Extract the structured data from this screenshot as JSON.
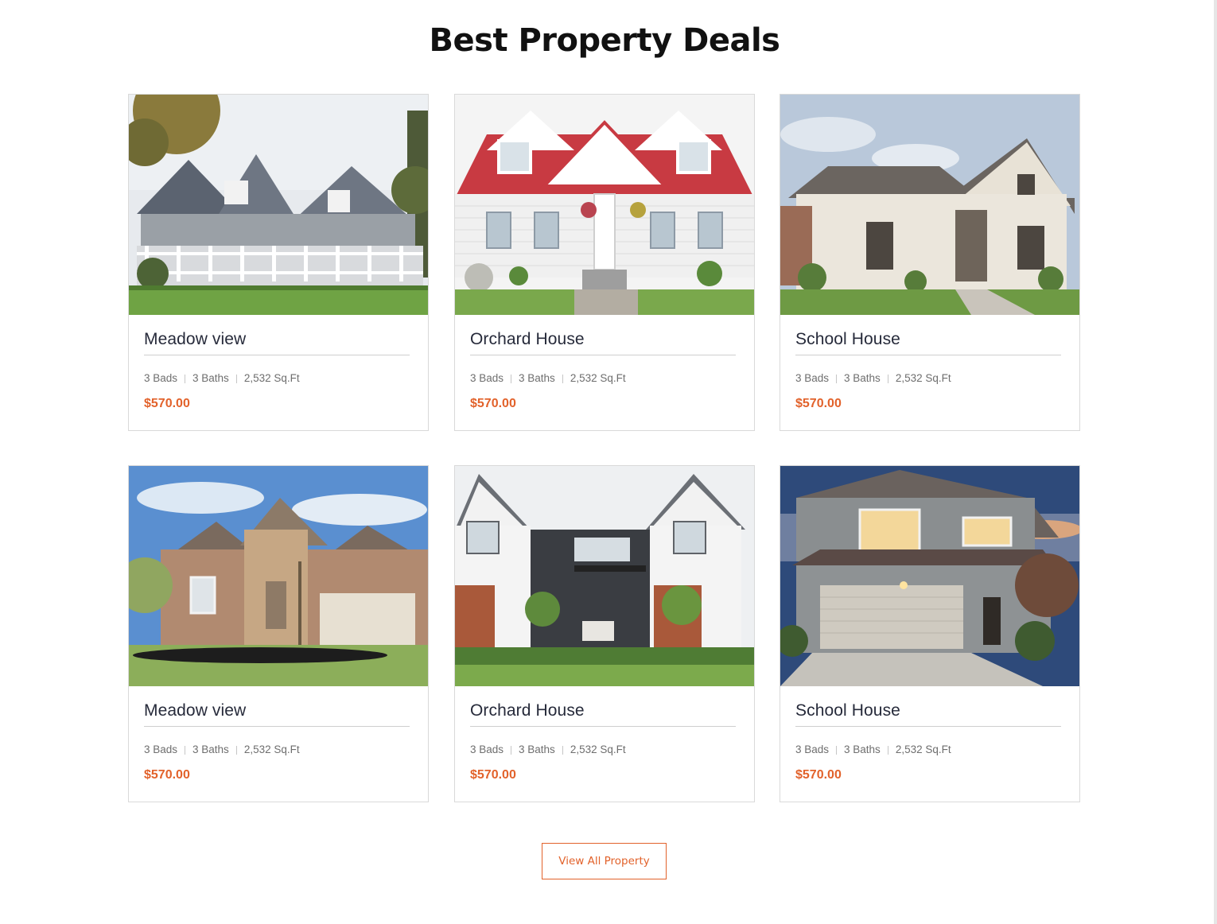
{
  "section": {
    "title": "Best Property Deals"
  },
  "properties": [
    {
      "name": "Meadow view",
      "beds": "3 Bads",
      "baths": "3 Baths",
      "area": "2,532 Sq.Ft",
      "price": "$570.00"
    },
    {
      "name": "Orchard House",
      "beds": "3 Bads",
      "baths": "3 Baths",
      "area": "2,532 Sq.Ft",
      "price": "$570.00"
    },
    {
      "name": "School House",
      "beds": "3 Bads",
      "baths": "3 Baths",
      "area": "2,532 Sq.Ft",
      "price": "$570.00"
    },
    {
      "name": "Meadow view",
      "beds": "3 Bads",
      "baths": "3 Baths",
      "area": "2,532 Sq.Ft",
      "price": "$570.00"
    },
    {
      "name": "Orchard House",
      "beds": "3 Bads",
      "baths": "3 Baths",
      "area": "2,532 Sq.Ft",
      "price": "$570.00"
    },
    {
      "name": "School House",
      "beds": "3 Bads",
      "baths": "3 Baths",
      "area": "2,532 Sq.Ft",
      "price": "$570.00"
    }
  ],
  "actions": {
    "view_all_label": "View All Property"
  },
  "colors": {
    "accent": "#e2622b",
    "heading": "#111111",
    "card_title": "#262a3a",
    "meta_text": "#6e6e6e"
  }
}
